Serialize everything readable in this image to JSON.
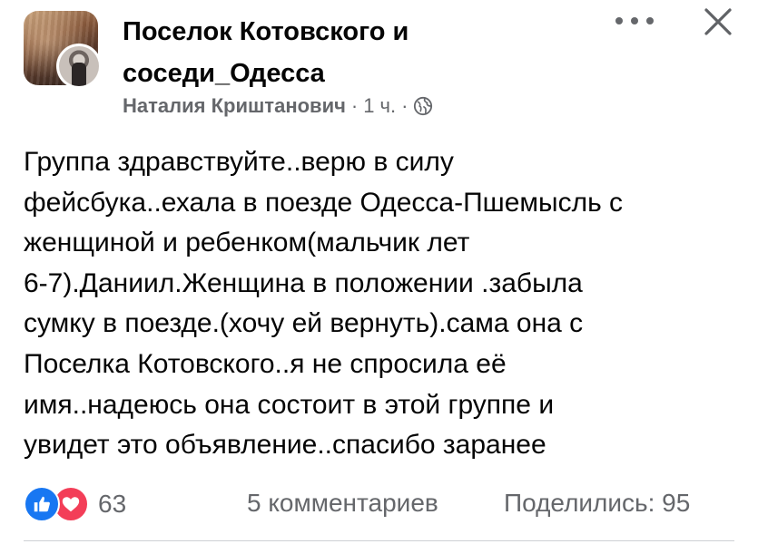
{
  "header": {
    "group_name": "Поселок Котовского и соседи_Одесса",
    "author": "Наталия Криштанович",
    "separator": "·",
    "time": "1 ч.",
    "separator2": "·",
    "privacy_icon": "globe-icon",
    "more_icon": "more-horizontal-icon",
    "close_icon": "close-icon"
  },
  "post": {
    "text": "Группа здравствуйте..верю в силу\nфейсбука..ехала в поезде Одесса-Пшемысль с\nженщиной и ребенком(мальчик лет\n6-7).Даниил.Женщина в положении .забыла\nсумку в поезде.(хочу ей вернуть).сама она с\nПоселка Котовского..я не спросила её\nимя..надеюсь она состоит в этой группе и\nувидет это объявление..спасибо заранее"
  },
  "footer": {
    "reaction_icons": [
      "like-icon",
      "love-icon"
    ],
    "reaction_count": "63",
    "comments": "5 комментариев",
    "shares": "Поделились: 95"
  },
  "colors": {
    "text": "#050505",
    "secondary": "#65676b",
    "like": "#1877f2",
    "love": "#f33e58"
  }
}
